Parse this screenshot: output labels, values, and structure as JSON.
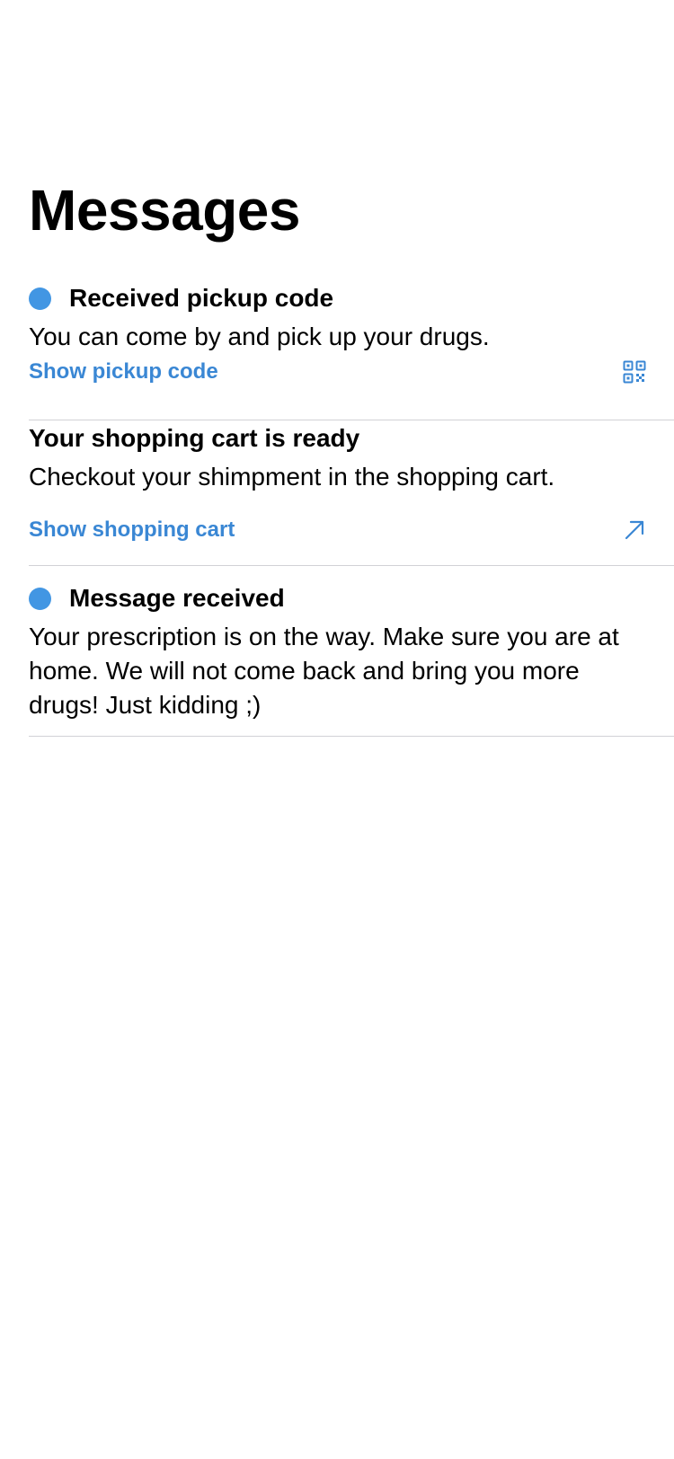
{
  "page": {
    "title": "Messages"
  },
  "messages": [
    {
      "unread": true,
      "title": "Received pickup code",
      "body": "You can come by and pick up your drugs.",
      "action_label": "Show pickup code",
      "action_icon": "qr-code-icon"
    },
    {
      "unread": false,
      "title": "Your shopping cart is ready",
      "body": "Checkout your shimpment in the shopping cart.",
      "action_label": "Show shopping cart",
      "action_icon": "arrow-up-right-icon"
    },
    {
      "unread": true,
      "title": "Message received",
      "body": "Your prescription is on the way. Make sure you are at home. We will not come back and bring you more drugs! Just kidding ;)"
    }
  ],
  "colors": {
    "accent": "#3a87d4",
    "unread_dot": "#4296e3",
    "divider": "#d1d1d6"
  }
}
